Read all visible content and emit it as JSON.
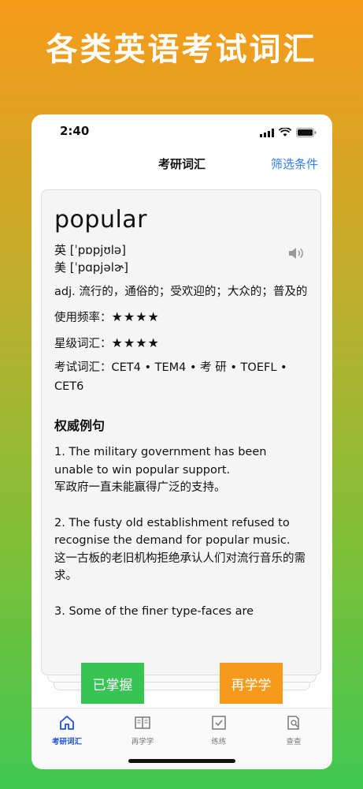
{
  "promo": {
    "headline": "各类英语考试词汇"
  },
  "status_bar": {
    "time": "2:40"
  },
  "nav": {
    "title": "考研词汇",
    "filter_label": "筛选条件"
  },
  "card": {
    "word": "popular",
    "uk_phonetic": "英 [ˈpɒpjʊlə]",
    "us_phonetic": "美 [ˈpɑpjəlɚ]",
    "definition": "adj. 流行的，通俗的；受欢迎的；大众的；普及的",
    "frequency_label": "使用频率：",
    "frequency_stars": "★★★★",
    "level_label": "星级词汇：",
    "level_stars": "★★★★",
    "exams": "考试词汇：CET4 • TEM4 • 考 研 • TOEFL • CET6",
    "examples_title": "权威例句",
    "examples": [
      {
        "en": "1. The military government has been unable to win popular support.",
        "zh": "军政府一直未能赢得广泛的支持。"
      },
      {
        "en": "2. The fusty old establishment refused to recognise the demand for popular music.",
        "zh": "这一古板的老旧机构拒绝承认人们对流行音乐的需求。"
      },
      {
        "en": "3. Some of the finer type-faces are",
        "zh": ""
      }
    ]
  },
  "actions": {
    "known_label": "已掌握",
    "again_label": "再学学"
  },
  "colors": {
    "known": "#37c453",
    "again": "#f59a1a",
    "accent": "#2f7ef5",
    "tab_active": "#1e4fd8"
  },
  "tabs": [
    {
      "label": "考研词汇",
      "icon": "home-icon",
      "active": true
    },
    {
      "label": "再学学",
      "icon": "book-icon",
      "active": false
    },
    {
      "label": "练练",
      "icon": "checkbox-icon",
      "active": false
    },
    {
      "label": "查查",
      "icon": "search-document-icon",
      "active": false
    }
  ]
}
